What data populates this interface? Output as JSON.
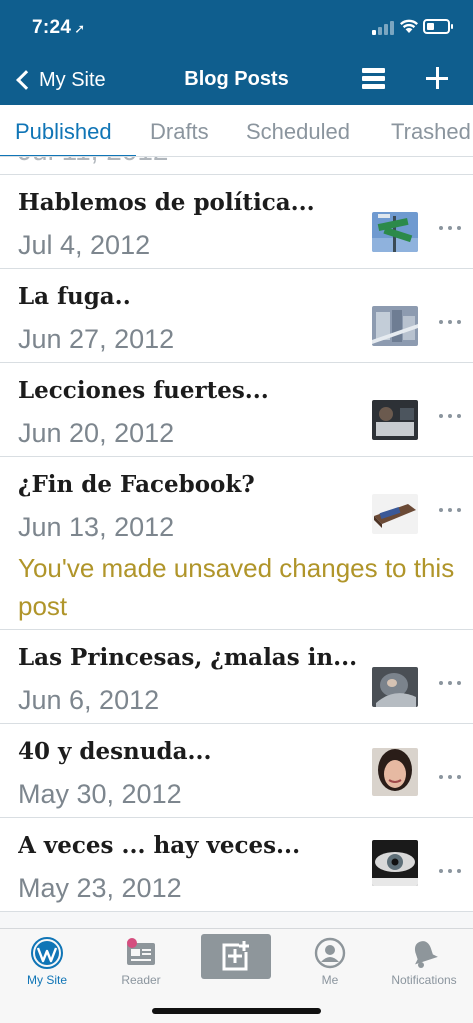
{
  "status_bar": {
    "time": "7:24",
    "location_glyph": "➚"
  },
  "nav": {
    "back_label": "My Site",
    "title": "Blog Posts"
  },
  "tabs": [
    {
      "label": "Published"
    },
    {
      "label": "Drafts"
    },
    {
      "label": "Scheduled"
    },
    {
      "label": "Trashed"
    }
  ],
  "posts": [
    {
      "title": "Hablemos de política...",
      "date": "Jul 4, 2012",
      "note": ""
    },
    {
      "title": "La fuga..",
      "date": "Jun 27, 2012",
      "note": ""
    },
    {
      "title": "Lecciones fuertes...",
      "date": "Jun 20, 2012",
      "note": ""
    },
    {
      "title": "¿Fin de Facebook?",
      "date": "Jun 13, 2012",
      "note": "You've made unsaved changes to this post"
    },
    {
      "title": "Las Princesas, ¿malas in...",
      "date": "Jun 6, 2012",
      "note": ""
    },
    {
      "title": "40 y desnuda...",
      "date": "May 30, 2012",
      "note": ""
    },
    {
      "title": "A veces ... hay veces...",
      "date": "May 23, 2012",
      "note": ""
    }
  ],
  "tabbar": {
    "items": [
      {
        "label": "My Site"
      },
      {
        "label": "Reader"
      },
      {
        "label": ""
      },
      {
        "label": "Me"
      },
      {
        "label": "Notifications"
      }
    ]
  },
  "colors": {
    "brand_blue": "#0f5e8e",
    "accent_blue": "#1075b6",
    "unsaved_note": "#b0952a",
    "reader_badge": "#d54e7f"
  }
}
